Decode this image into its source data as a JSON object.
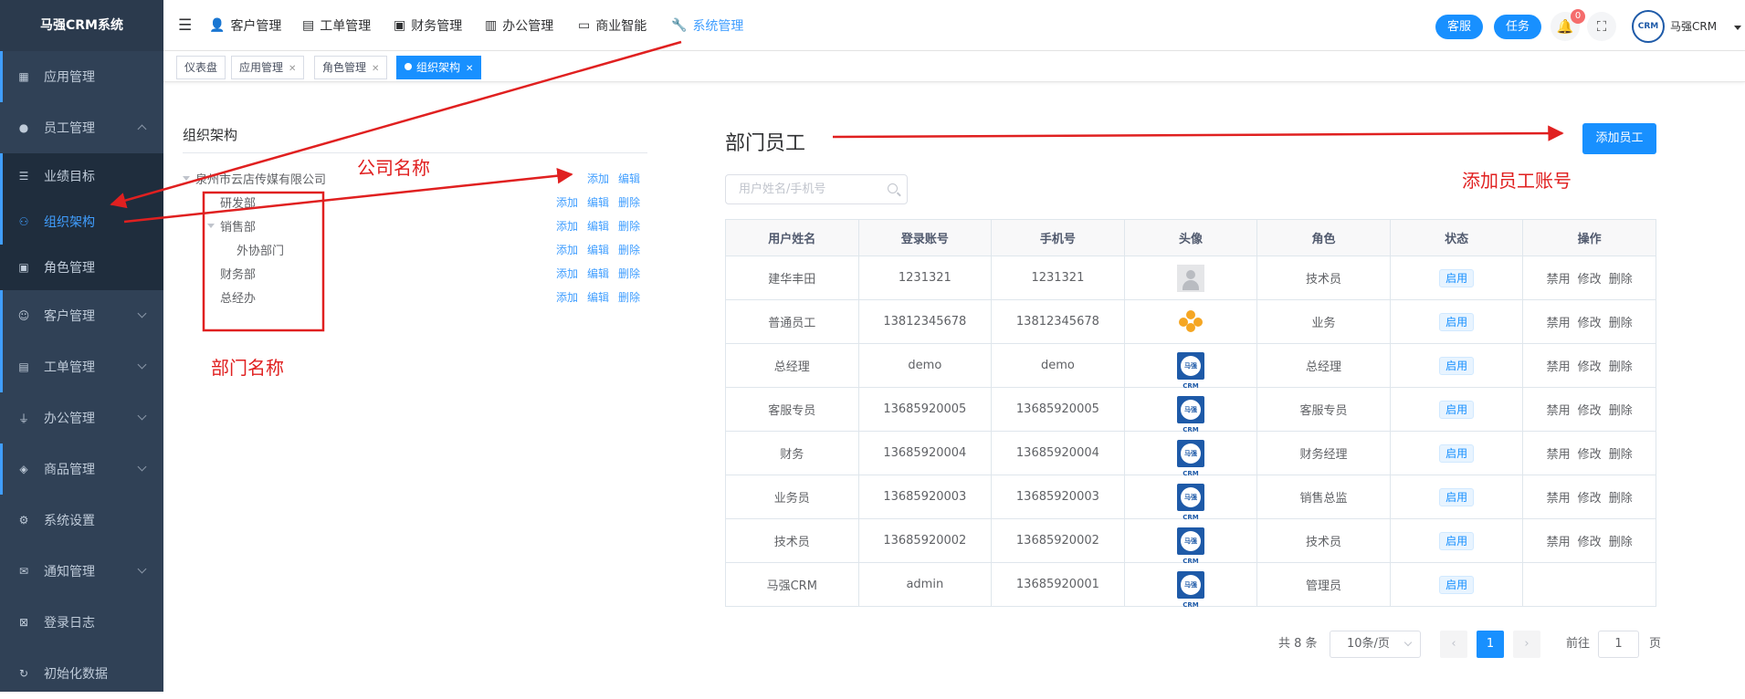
{
  "sidebar": {
    "title": "马强CRM系统",
    "items": [
      {
        "label": "应用管理"
      },
      {
        "label": "员工管理"
      },
      {
        "label": "业绩目标"
      },
      {
        "label": "组织架构"
      },
      {
        "label": "角色管理"
      },
      {
        "label": "客户管理"
      },
      {
        "label": "工单管理"
      },
      {
        "label": "办公管理"
      },
      {
        "label": "商品管理"
      },
      {
        "label": "系统设置"
      },
      {
        "label": "通知管理"
      },
      {
        "label": "登录日志"
      },
      {
        "label": "初始化数据"
      }
    ]
  },
  "topnav": {
    "items": [
      {
        "label": "客户管理"
      },
      {
        "label": "工单管理"
      },
      {
        "label": "财务管理"
      },
      {
        "label": "办公管理"
      },
      {
        "label": "商业智能"
      },
      {
        "label": "系统管理"
      }
    ],
    "service_label": "客服",
    "task_label": "任务",
    "notify_count": "0",
    "user_name": "马强CRM",
    "avatar_text": "CRM"
  },
  "tabs": [
    {
      "label": "仪表盘"
    },
    {
      "label": "应用管理"
    },
    {
      "label": "角色管理"
    },
    {
      "label": "组织架构"
    }
  ],
  "org": {
    "title": "组织架构",
    "add_label": "添加",
    "edit_label": "编辑",
    "delete_label": "删除",
    "nodes": [
      {
        "name": "泉州市云店传媒有限公司"
      },
      {
        "name": "研发部"
      },
      {
        "name": "销售部"
      },
      {
        "name": "外协部门"
      },
      {
        "name": "财务部"
      },
      {
        "name": "总经办"
      }
    ]
  },
  "dept": {
    "title": "部门员工",
    "add_button": "添加员工",
    "search_placeholder": "用户姓名/手机号",
    "columns": [
      "用户姓名",
      "登录账号",
      "手机号",
      "头像",
      "角色",
      "状态",
      "操作"
    ],
    "rows": [
      {
        "name": "建华丰田",
        "account": "1231321",
        "phone": "1231321",
        "avatar": "default-avatar",
        "role": "技术员",
        "status": "启用",
        "ops": [
          "禁用",
          "修改",
          "删除"
        ]
      },
      {
        "name": "普通员工",
        "account": "13812345678",
        "phone": "13812345678",
        "avatar": "team-avatar",
        "role": "业务",
        "status": "启用",
        "ops": [
          "禁用",
          "修改",
          "删除"
        ]
      },
      {
        "name": "总经理",
        "account": "demo",
        "phone": "demo",
        "avatar": "crm-logo",
        "role": "总经理",
        "status": "启用",
        "ops": [
          "禁用",
          "修改",
          "删除"
        ]
      },
      {
        "name": "客服专员",
        "account": "13685920005",
        "phone": "13685920005",
        "avatar": "crm-logo",
        "role": "客服专员",
        "status": "启用",
        "ops": [
          "禁用",
          "修改",
          "删除"
        ]
      },
      {
        "name": "财务",
        "account": "13685920004",
        "phone": "13685920004",
        "avatar": "crm-logo",
        "role": "财务经理",
        "status": "启用",
        "ops": [
          "禁用",
          "修改",
          "删除"
        ]
      },
      {
        "name": "业务员",
        "account": "13685920003",
        "phone": "13685920003",
        "avatar": "crm-logo",
        "role": "销售总监",
        "status": "启用",
        "ops": [
          "禁用",
          "修改",
          "删除"
        ]
      },
      {
        "name": "技术员",
        "account": "13685920002",
        "phone": "13685920002",
        "avatar": "crm-logo",
        "role": "技术员",
        "status": "启用",
        "ops": [
          "禁用",
          "修改",
          "删除"
        ]
      },
      {
        "name": "马强CRM",
        "account": "admin",
        "phone": "13685920001",
        "avatar": "crm-logo",
        "role": "管理员",
        "status": "启用",
        "ops": []
      }
    ],
    "crm_logo_text": "马强CRM"
  },
  "pager": {
    "total_label": "共 8 条",
    "page_size": "10条/页",
    "current_page": "1",
    "goto_label": "前往",
    "goto_value": "1",
    "page_suffix": "页"
  },
  "annotations": {
    "company": "公司名称",
    "dept": "部门名称",
    "add_account": "添加员工账号"
  },
  "colors": {
    "accent": "#1890ff",
    "sidebar": "#304156",
    "annotation": "#e02020"
  }
}
